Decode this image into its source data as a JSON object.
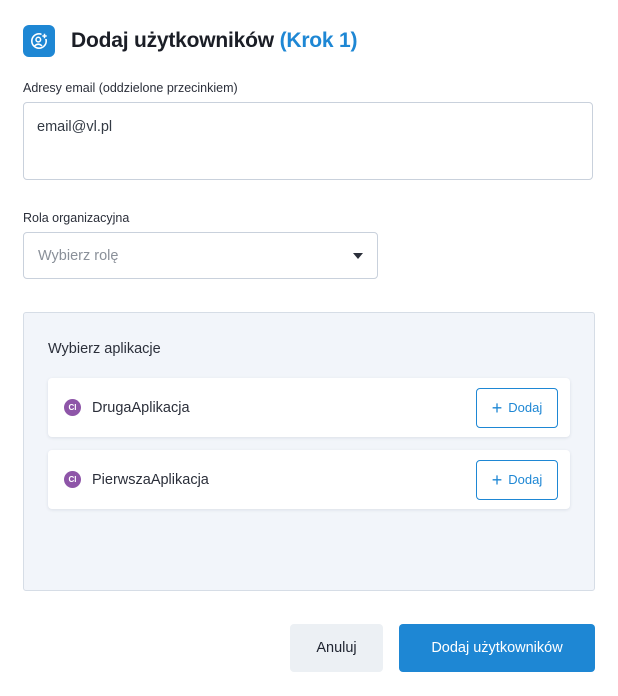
{
  "dialog": {
    "title": "Dodaj użytkowników",
    "step": "(Krok 1)"
  },
  "email": {
    "label": "Adresy email (oddzielone przecinkiem)",
    "value": "email@vl.pl"
  },
  "role": {
    "label": "Rola organizacyjna",
    "placeholder": "Wybierz rolę"
  },
  "apps": {
    "title": "Wybierz aplikacje",
    "items": [
      {
        "badge": "CI",
        "name": "DrugaAplikacja",
        "add_label": "Dodaj"
      },
      {
        "badge": "CI",
        "name": "PierwszaAplikacja",
        "add_label": "Dodaj"
      }
    ]
  },
  "footer": {
    "cancel_label": "Anuluj",
    "submit_label": "Dodaj użytkowników"
  },
  "colors": {
    "accent": "#1e87d4",
    "app_badge": "#8e55a8",
    "panel_bg": "#f2f5fa"
  }
}
